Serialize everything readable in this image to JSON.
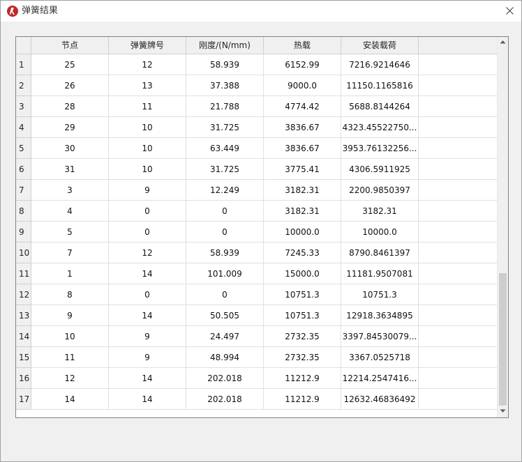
{
  "window": {
    "title": "弹簧结果"
  },
  "table": {
    "columns": [
      "节点",
      "弹簧牌号",
      "刚度/(N/mm)",
      "热载",
      "安装载荷"
    ],
    "rows": [
      {
        "num": "1",
        "cells": [
          "25",
          "12",
          "58.939",
          "6152.99",
          "7216.9214646"
        ]
      },
      {
        "num": "2",
        "cells": [
          "26",
          "13",
          "37.388",
          "9000.0",
          "11150.1165816"
        ]
      },
      {
        "num": "3",
        "cells": [
          "28",
          "11",
          "21.788",
          "4774.42",
          "5688.8144264"
        ]
      },
      {
        "num": "4",
        "cells": [
          "29",
          "10",
          "31.725",
          "3836.67",
          "4323.45522750..."
        ]
      },
      {
        "num": "5",
        "cells": [
          "30",
          "10",
          "63.449",
          "3836.67",
          "3953.76132256..."
        ]
      },
      {
        "num": "6",
        "cells": [
          "31",
          "10",
          "31.725",
          "3775.41",
          "4306.5911925"
        ]
      },
      {
        "num": "7",
        "cells": [
          "3",
          "9",
          "12.249",
          "3182.31",
          "2200.9850397"
        ]
      },
      {
        "num": "8",
        "cells": [
          "4",
          "0",
          "0",
          "3182.31",
          "3182.31"
        ]
      },
      {
        "num": "9",
        "cells": [
          "5",
          "0",
          "0",
          "10000.0",
          "10000.0"
        ]
      },
      {
        "num": "10",
        "cells": [
          "7",
          "12",
          "58.939",
          "7245.33",
          "8790.8461397"
        ]
      },
      {
        "num": "11",
        "cells": [
          "1",
          "14",
          "101.009",
          "15000.0",
          "11181.9507081"
        ]
      },
      {
        "num": "12",
        "cells": [
          "8",
          "0",
          "0",
          "10751.3",
          "10751.3"
        ]
      },
      {
        "num": "13",
        "cells": [
          "9",
          "14",
          "50.505",
          "10751.3",
          "12918.3634895"
        ]
      },
      {
        "num": "14",
        "cells": [
          "10",
          "9",
          "24.497",
          "2732.35",
          "3397.84530079..."
        ]
      },
      {
        "num": "15",
        "cells": [
          "11",
          "9",
          "48.994",
          "2732.35",
          "3367.0525718"
        ]
      },
      {
        "num": "16",
        "cells": [
          "12",
          "14",
          "202.018",
          "11212.9",
          "12214.2547416..."
        ]
      },
      {
        "num": "17",
        "cells": [
          "14",
          "14",
          "202.018",
          "11212.9",
          "12632.46836492"
        ]
      }
    ]
  },
  "icons": {
    "app": "app-logo-icon",
    "close": "close-icon",
    "scroll_up": "arrow-up-icon",
    "scroll_down": "arrow-down-icon"
  }
}
